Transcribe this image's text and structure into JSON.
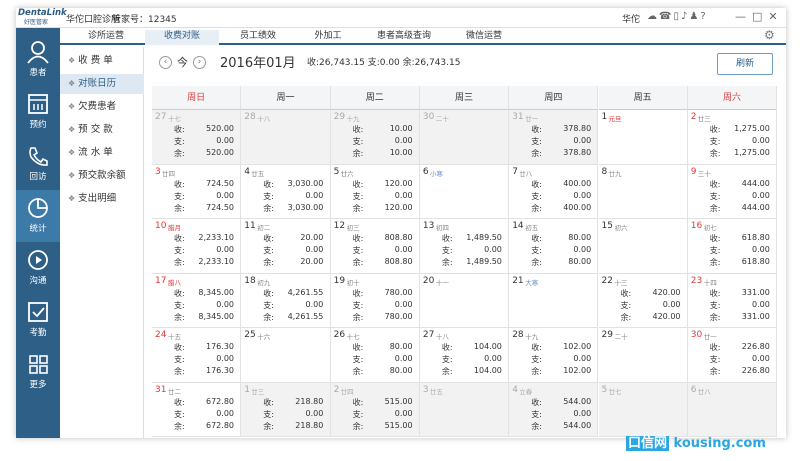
{
  "titlebar": {
    "logo_top": "DentaLink",
    "logo_bottom": "好医管家",
    "clinic": "华佗口腔诊所",
    "admin_id": "管家号：12345",
    "user": "华佗",
    "icons": [
      "wechat-icon",
      "phone-icon",
      "tablet-icon",
      "bell-icon",
      "tshirt-icon",
      "help-icon"
    ],
    "window_controls": [
      "—",
      "□",
      "✕"
    ]
  },
  "sidebar": [
    {
      "label": "患者",
      "icon": "person-icon"
    },
    {
      "label": "预约",
      "icon": "calendar-icon"
    },
    {
      "label": "回访",
      "icon": "phone-call-icon"
    },
    {
      "label": "统计",
      "icon": "pie-chart-icon"
    },
    {
      "label": "沟通",
      "icon": "play-circle-icon"
    },
    {
      "label": "考勤",
      "icon": "checklist-icon"
    },
    {
      "label": "更多",
      "icon": "grid-icon"
    }
  ],
  "tabs": [
    "诊所运营",
    "收费对账",
    "员工绩效",
    "外加工",
    "患者高级查询",
    "微信运营"
  ],
  "subnav": [
    "收 费 单",
    "对账日历",
    "欠费患者",
    "预 交 款",
    "流 水 单",
    "预交款余额",
    "支出明细"
  ],
  "toolbar": {
    "today": "今",
    "month": "2016年01月",
    "summary": "收:26,743.15  支:0.00  余:26,743.15",
    "refresh": "刷新"
  },
  "weekdays": [
    "周日",
    "周一",
    "周二",
    "周三",
    "周四",
    "周五",
    "周六"
  ],
  "labels": {
    "income": "收:",
    "expense": "支:",
    "balance": "余:"
  },
  "weeks": [
    [
      {
        "d": "27",
        "l": "十七",
        "o": true,
        "i": "520.00",
        "e": "0.00",
        "b": "520.00"
      },
      {
        "d": "28",
        "l": "十八",
        "o": true
      },
      {
        "d": "29",
        "l": "十九",
        "o": true,
        "i": "10.00",
        "e": "0.00",
        "b": "10.00"
      },
      {
        "d": "30",
        "l": "二十",
        "o": true
      },
      {
        "d": "31",
        "l": "廿一",
        "o": true,
        "i": "378.80",
        "e": "0.00",
        "b": "378.80"
      },
      {
        "d": "1",
        "l": "元旦",
        "f": true
      },
      {
        "d": "2",
        "l": "廿三",
        "i": "1,275.00",
        "e": "0.00",
        "b": "1,275.00"
      }
    ],
    [
      {
        "d": "3",
        "l": "廿四",
        "i": "724.50",
        "e": "0.00",
        "b": "724.50"
      },
      {
        "d": "4",
        "l": "廿五",
        "i": "3,030.00",
        "e": "0.00",
        "b": "3,030.00"
      },
      {
        "d": "5",
        "l": "廿六",
        "i": "120.00",
        "e": "0.00",
        "b": "120.00"
      },
      {
        "d": "6",
        "l": "小寒",
        "t": true
      },
      {
        "d": "7",
        "l": "廿八",
        "i": "400.00",
        "e": "0.00",
        "b": "400.00"
      },
      {
        "d": "8",
        "l": "廿九"
      },
      {
        "d": "9",
        "l": "三十",
        "i": "444.00",
        "e": "0.00",
        "b": "444.00"
      }
    ],
    [
      {
        "d": "10",
        "l": "腊月",
        "f": true,
        "i": "2,233.10",
        "e": "0.00",
        "b": "2,233.10"
      },
      {
        "d": "11",
        "l": "初二",
        "i": "20.00",
        "e": "0.00",
        "b": "20.00"
      },
      {
        "d": "12",
        "l": "初三",
        "i": "808.80",
        "e": "0.00",
        "b": "808.80"
      },
      {
        "d": "13",
        "l": "初四",
        "i": "1,489.50",
        "e": "0.00",
        "b": "1,489.50"
      },
      {
        "d": "14",
        "l": "初五",
        "i": "80.00",
        "e": "0.00",
        "b": "80.00"
      },
      {
        "d": "15",
        "l": "初六"
      },
      {
        "d": "16",
        "l": "初七",
        "i": "618.80",
        "e": "0.00",
        "b": "618.80"
      }
    ],
    [
      {
        "d": "17",
        "l": "腊八",
        "f": true,
        "i": "8,345.00",
        "e": "0.00",
        "b": "8,345.00"
      },
      {
        "d": "18",
        "l": "初九",
        "i": "4,261.55",
        "e": "0.00",
        "b": "4,261.55"
      },
      {
        "d": "19",
        "l": "初十",
        "i": "780.00",
        "e": "0.00",
        "b": "780.00"
      },
      {
        "d": "20",
        "l": "十一"
      },
      {
        "d": "21",
        "l": "大寒",
        "t": true
      },
      {
        "d": "22",
        "l": "十三",
        "i": "420.00",
        "e": "0.00",
        "b": "420.00"
      },
      {
        "d": "23",
        "l": "十四",
        "i": "331.00",
        "e": "0.00",
        "b": "331.00"
      }
    ],
    [
      {
        "d": "24",
        "l": "十五",
        "i": "176.30",
        "e": "0.00",
        "b": "176.30"
      },
      {
        "d": "25",
        "l": "十六"
      },
      {
        "d": "26",
        "l": "十七",
        "i": "80.00",
        "e": "0.00",
        "b": "80.00"
      },
      {
        "d": "27",
        "l": "十八",
        "i": "104.00",
        "e": "0.00",
        "b": "104.00"
      },
      {
        "d": "28",
        "l": "十九",
        "i": "102.00",
        "e": "0.00",
        "b": "102.00"
      },
      {
        "d": "29",
        "l": "二十"
      },
      {
        "d": "30",
        "l": "廿一",
        "i": "226.80",
        "e": "0.00",
        "b": "226.80"
      }
    ],
    [
      {
        "d": "31",
        "l": "廿二",
        "i": "672.80",
        "e": "0.00",
        "b": "672.80"
      },
      {
        "d": "1",
        "l": "廿三",
        "o": true,
        "i": "218.80",
        "e": "0.00",
        "b": "218.80"
      },
      {
        "d": "2",
        "l": "廿四",
        "o": true,
        "i": "515.00",
        "e": "0.00",
        "b": "515.00"
      },
      {
        "d": "3",
        "l": "廿五",
        "o": true
      },
      {
        "d": "4",
        "l": "立春",
        "o": true,
        "t": true,
        "i": "544.00",
        "e": "0.00",
        "b": "544.00"
      },
      {
        "d": "5",
        "l": "廿七",
        "o": true
      },
      {
        "d": "6",
        "l": "廿八",
        "o": true
      }
    ]
  ],
  "watermark": {
    "prefix": "口信网",
    "domain": "kousing.com"
  }
}
